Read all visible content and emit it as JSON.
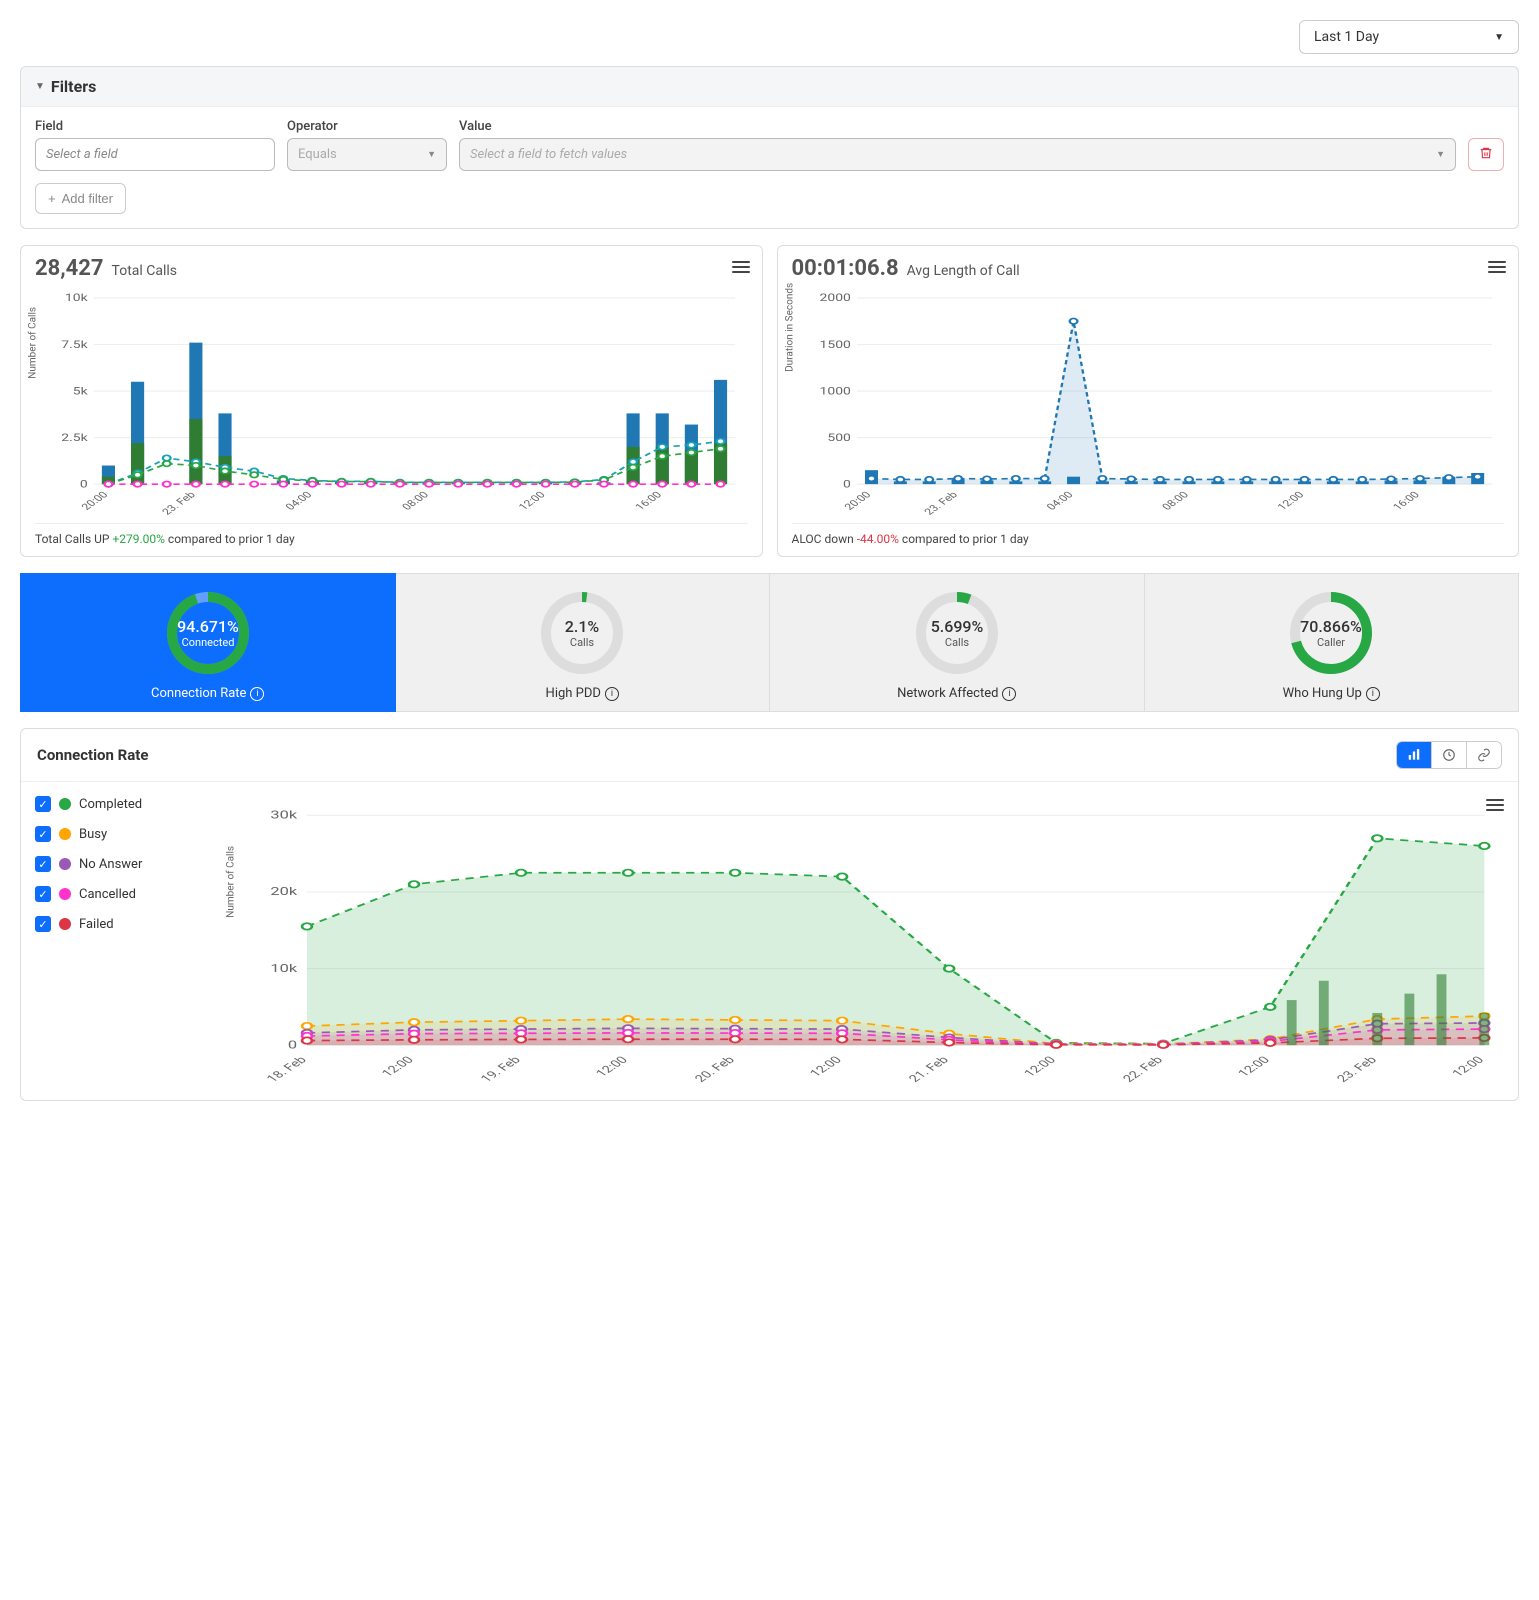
{
  "time_range": {
    "label": "Last 1 Day"
  },
  "filters": {
    "title": "Filters",
    "field_label": "Field",
    "field_placeholder": "Select a field",
    "operator_label": "Operator",
    "operator_value": "Equals",
    "value_label": "Value",
    "value_placeholder": "Select a field to fetch values",
    "add_filter_label": "Add filter"
  },
  "total_calls": {
    "value": "28,427",
    "label": "Total Calls",
    "footer_prefix": "Total Calls UP ",
    "footer_change": "+279.00%",
    "footer_suffix": " compared to prior 1 day",
    "ylabel": "Number of Calls"
  },
  "aloc": {
    "value": "00:01:06.8",
    "label": "Avg Length of Call",
    "footer_prefix": "ALOC down ",
    "footer_change": "-44.00%",
    "footer_suffix": " compared to prior 1 day",
    "ylabel": "Duration in Seconds"
  },
  "kpis": [
    {
      "pct": "94.671%",
      "sub": "Connected",
      "title": "Connection Rate",
      "fill": 94.671,
      "color": "#28a745",
      "active": true
    },
    {
      "pct": "2.1%",
      "sub": "Calls",
      "title": "High PDD",
      "fill": 2.1,
      "color": "#28a745",
      "active": false
    },
    {
      "pct": "5.699%",
      "sub": "Calls",
      "title": "Network Affected",
      "fill": 5.699,
      "color": "#28a745",
      "active": false
    },
    {
      "pct": "70.866%",
      "sub": "Caller",
      "title": "Who Hung Up",
      "fill": 70.866,
      "color": "#28a745",
      "active": false
    }
  ],
  "detail": {
    "title": "Connection Rate",
    "ylabel": "Number of Calls",
    "legend": [
      {
        "label": "Completed",
        "color": "#28a745"
      },
      {
        "label": "Busy",
        "color": "#ffa500"
      },
      {
        "label": "No Answer",
        "color": "#9b59b6"
      },
      {
        "label": "Cancelled",
        "color": "#ff33cc"
      },
      {
        "label": "Failed",
        "color": "#dc3545"
      }
    ]
  },
  "chart_data": [
    {
      "id": "total_calls",
      "type": "bar",
      "ylabel": "Number of Calls",
      "ylim": [
        0,
        10000
      ],
      "yticks": [
        0,
        2500,
        5000,
        7500,
        10000
      ],
      "ytick_labels": [
        "0",
        "2.5k",
        "5k",
        "7.5k",
        "10k"
      ],
      "categories": [
        "20:00",
        "",
        "",
        "23. Feb",
        "",
        "",
        "",
        "04:00",
        "",
        "",
        "",
        "08:00",
        "",
        "",
        "",
        "12:00",
        "",
        "",
        "",
        "16:00",
        "",
        ""
      ],
      "series": [
        {
          "name": "bars_blue",
          "type": "bar",
          "color": "#1f77b4",
          "values": [
            1000,
            5500,
            0,
            7600,
            3800,
            0,
            200,
            200,
            150,
            150,
            100,
            100,
            100,
            100,
            100,
            100,
            100,
            100,
            3800,
            3800,
            3200,
            5600
          ]
        },
        {
          "name": "bars_green_overlay",
          "type": "bar",
          "color": "#2e7d32",
          "values": [
            400,
            2200,
            0,
            3500,
            1500,
            0,
            80,
            80,
            70,
            70,
            60,
            60,
            60,
            60,
            60,
            60,
            60,
            60,
            2000,
            2000,
            1800,
            2200
          ]
        },
        {
          "name": "line_teal",
          "type": "line",
          "color": "#17a2b8",
          "values": [
            0,
            600,
            1400,
            1200,
            900,
            700,
            300,
            200,
            150,
            150,
            100,
            100,
            100,
            100,
            100,
            100,
            120,
            250,
            1200,
            2000,
            2100,
            2300
          ]
        },
        {
          "name": "line_green",
          "type": "line",
          "color": "#28a745",
          "values": [
            0,
            500,
            1100,
            1000,
            700,
            500,
            250,
            180,
            140,
            140,
            90,
            90,
            90,
            90,
            90,
            90,
            110,
            220,
            900,
            1500,
            1700,
            1900
          ]
        },
        {
          "name": "line_magenta",
          "type": "line",
          "color": "#ff33cc",
          "values": [
            0,
            0,
            0,
            0,
            0,
            0,
            0,
            0,
            0,
            0,
            0,
            0,
            0,
            0,
            0,
            0,
            0,
            0,
            0,
            0,
            0,
            0
          ]
        }
      ]
    },
    {
      "id": "aloc",
      "type": "line",
      "ylabel": "Duration in Seconds",
      "ylim": [
        0,
        2000
      ],
      "yticks": [
        0,
        500,
        1000,
        1500,
        2000
      ],
      "categories": [
        "20:00",
        "",
        "",
        "23. Feb",
        "",
        "",
        "",
        "04:00",
        "",
        "",
        "",
        "08:00",
        "",
        "",
        "",
        "12:00",
        "",
        "",
        "",
        "16:00",
        "",
        ""
      ],
      "series": [
        {
          "name": "bars",
          "type": "bar",
          "color": "#1f77b4",
          "values": [
            150,
            30,
            30,
            60,
            40,
            30,
            30,
            80,
            30,
            30,
            30,
            30,
            30,
            30,
            30,
            30,
            30,
            30,
            40,
            40,
            80,
            120
          ]
        },
        {
          "name": "avg_line",
          "type": "area",
          "color": "#1f77b4",
          "values": [
            60,
            50,
            50,
            60,
            55,
            60,
            60,
            1750,
            60,
            55,
            50,
            50,
            50,
            50,
            50,
            50,
            50,
            50,
            55,
            60,
            70,
            80
          ]
        }
      ]
    },
    {
      "id": "connection_rate_ts",
      "type": "area",
      "ylabel": "Number of Calls",
      "ylim": [
        0,
        30000
      ],
      "yticks": [
        0,
        10000,
        20000,
        30000
      ],
      "ytick_labels": [
        "0",
        "10k",
        "20k",
        "30k"
      ],
      "categories": [
        "18. Feb",
        "12:00",
        "19. Feb",
        "12:00",
        "20. Feb",
        "12:00",
        "21. Feb",
        "12:00",
        "22. Feb",
        "12:00",
        "23. Feb",
        "12:00"
      ],
      "series": [
        {
          "name": "Completed",
          "color": "#28a745",
          "values": [
            15500,
            21000,
            22500,
            22500,
            22500,
            22000,
            10000,
            300,
            200,
            5000,
            27000,
            26000
          ]
        },
        {
          "name": "Busy",
          "color": "#ffa500",
          "values": [
            2500,
            3000,
            3200,
            3400,
            3300,
            3200,
            1500,
            200,
            150,
            800,
            3400,
            3800
          ]
        },
        {
          "name": "No Answer",
          "color": "#9b59b6",
          "values": [
            1600,
            2000,
            2100,
            2200,
            2150,
            2100,
            1000,
            150,
            120,
            700,
            2800,
            2900
          ]
        },
        {
          "name": "Cancelled",
          "color": "#ff33cc",
          "values": [
            1200,
            1500,
            1550,
            1600,
            1580,
            1550,
            700,
            100,
            90,
            500,
            2000,
            2100
          ]
        },
        {
          "name": "Failed",
          "color": "#dc3545",
          "values": [
            600,
            700,
            750,
            780,
            770,
            760,
            350,
            50,
            45,
            300,
            900,
            950
          ]
        }
      ]
    }
  ]
}
